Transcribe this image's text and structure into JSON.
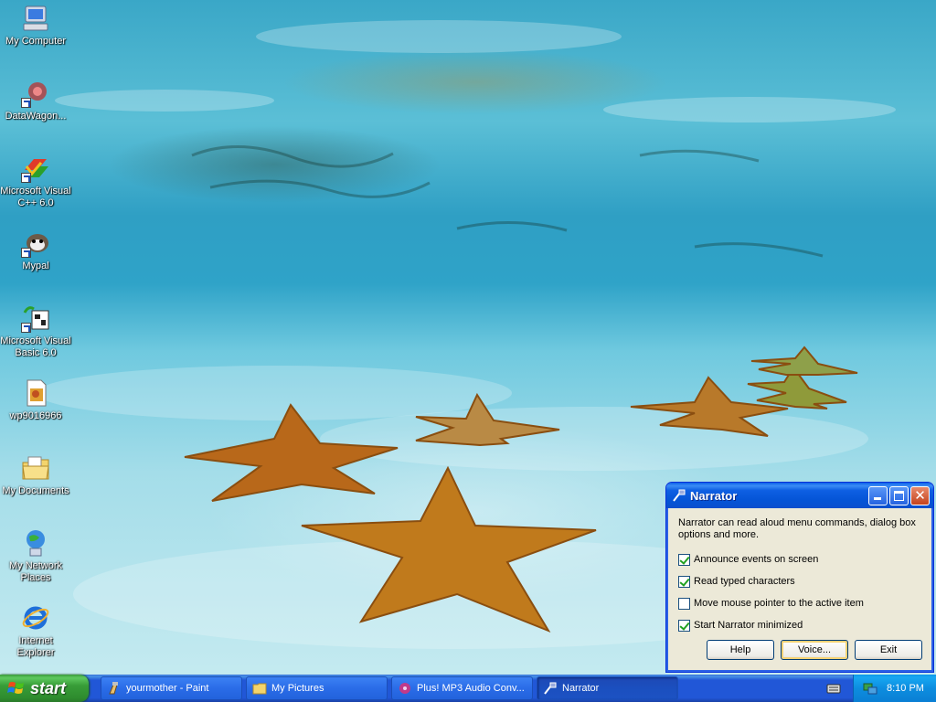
{
  "desktop": {
    "icons": [
      {
        "label": "My Computer",
        "icon": "my-computer-icon"
      },
      {
        "label": "DataWagon...",
        "icon": "datawagon-icon"
      },
      {
        "label": "Microsoft Visual C++ 6.0",
        "icon": "visual-cpp-icon"
      },
      {
        "label": "Mypal",
        "icon": "mypal-icon"
      },
      {
        "label": "Microsoft Visual Basic 6.0",
        "icon": "visual-basic-icon"
      },
      {
        "label": "wp9016966",
        "icon": "image-file-icon"
      },
      {
        "label": "My Documents",
        "icon": "my-documents-icon"
      },
      {
        "label": "My Network Places",
        "icon": "network-places-icon"
      },
      {
        "label": "Internet Explorer",
        "icon": "internet-explorer-icon"
      }
    ]
  },
  "narrator": {
    "title": "Narrator",
    "description": "Narrator can read aloud menu commands, dialog box options and more.",
    "options": [
      {
        "label": "Announce events on screen",
        "checked": true
      },
      {
        "label": "Read typed characters",
        "checked": true
      },
      {
        "label": "Move mouse pointer to the active item",
        "checked": false
      },
      {
        "label": "Start Narrator minimized",
        "checked": true
      }
    ],
    "buttons": {
      "help": "Help",
      "voice": "Voice...",
      "exit": "Exit"
    }
  },
  "taskbar": {
    "start_label": "start",
    "tasks": [
      {
        "label": "yourmother - Paint",
        "icon": "paint-icon",
        "active": false
      },
      {
        "label": "My Pictures",
        "icon": "folder-icon",
        "active": false
      },
      {
        "label": "Plus! MP3 Audio Conv...",
        "icon": "audio-converter-icon",
        "active": false
      },
      {
        "label": "Narrator",
        "icon": "narrator-icon",
        "active": true
      }
    ],
    "clock": "8:10 PM"
  }
}
